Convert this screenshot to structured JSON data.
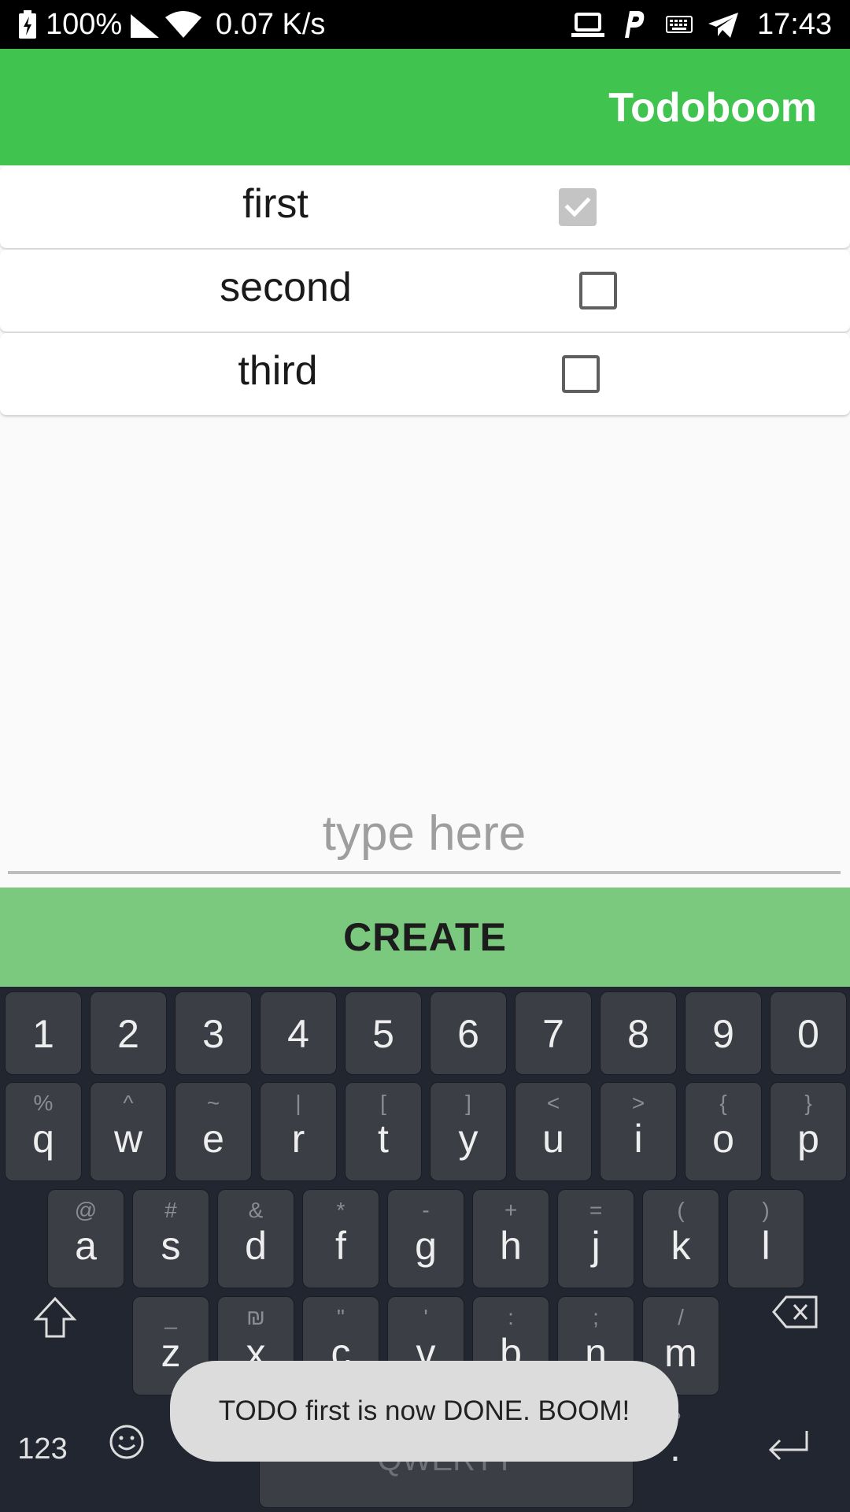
{
  "status_bar": {
    "battery": "100%",
    "speed": "0.07 K/s",
    "time": "17:43",
    "icons": [
      "battery-charging-icon",
      "signal-icon",
      "wifi-icon",
      "laptop-icon",
      "p-icon",
      "keyboard-icon",
      "telegram-icon"
    ]
  },
  "app": {
    "title": "Todoboom"
  },
  "todos": [
    {
      "label": "first",
      "checked": true
    },
    {
      "label": "second",
      "checked": false
    },
    {
      "label": "third",
      "checked": false
    }
  ],
  "input": {
    "placeholder": "type here",
    "value": ""
  },
  "create_button": {
    "label": "CREATE"
  },
  "keyboard": {
    "numbers": [
      "1",
      "2",
      "3",
      "4",
      "5",
      "6",
      "7",
      "8",
      "9",
      "0"
    ],
    "row1": [
      {
        "m": "q",
        "s": "%"
      },
      {
        "m": "w",
        "s": "^"
      },
      {
        "m": "e",
        "s": "~"
      },
      {
        "m": "r",
        "s": "|"
      },
      {
        "m": "t",
        "s": "["
      },
      {
        "m": "y",
        "s": "]"
      },
      {
        "m": "u",
        "s": "<"
      },
      {
        "m": "i",
        "s": ">"
      },
      {
        "m": "o",
        "s": "{"
      },
      {
        "m": "p",
        "s": "}"
      }
    ],
    "row2": [
      {
        "m": "a",
        "s": "@"
      },
      {
        "m": "s",
        "s": "#"
      },
      {
        "m": "d",
        "s": "&"
      },
      {
        "m": "f",
        "s": "*"
      },
      {
        "m": "g",
        "s": "-"
      },
      {
        "m": "h",
        "s": "+"
      },
      {
        "m": "j",
        "s": "="
      },
      {
        "m": "k",
        "s": "("
      },
      {
        "m": "l",
        "s": ")"
      }
    ],
    "row3": [
      {
        "m": "z",
        "s": "_"
      },
      {
        "m": "x",
        "s": "₪"
      },
      {
        "m": "c",
        "s": "\""
      },
      {
        "m": "v",
        "s": "'"
      },
      {
        "m": "b",
        "s": ":"
      },
      {
        "m": "n",
        "s": ";"
      },
      {
        "m": "m",
        "s": "/"
      }
    ],
    "numbers_label": "123",
    "comma": ",",
    "space_label": "QWERTY",
    "period": ".",
    "period_hint": "!?"
  },
  "toast": {
    "message": "TODO first is now DONE. BOOM!"
  },
  "colors": {
    "app_bar": "#41c44f",
    "create_button": "#7bc97f",
    "keyboard_bg": "#222630",
    "key_bg": "#3b3e45"
  }
}
